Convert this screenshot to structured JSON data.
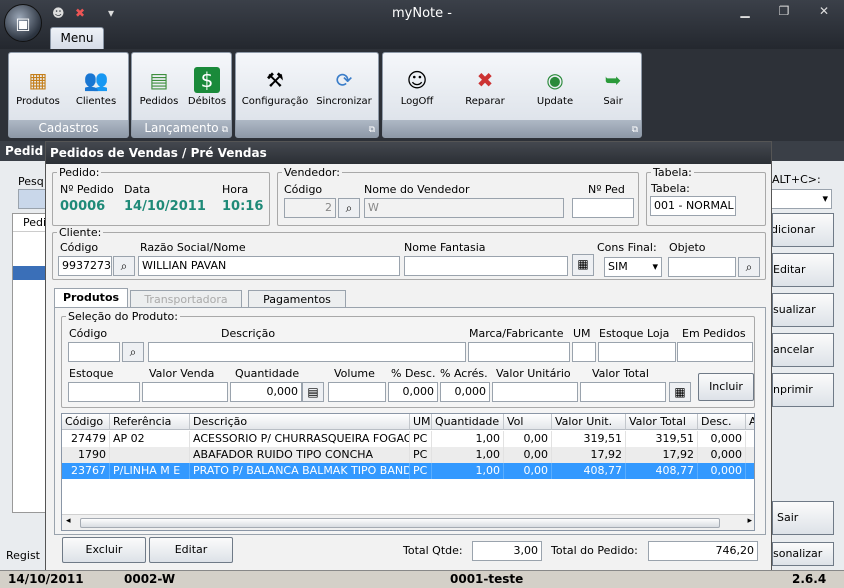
{
  "app": {
    "title": "myNote -",
    "menu_tab": "Menu"
  },
  "ribbon": {
    "groups": [
      {
        "label": "Cadastros",
        "items": [
          {
            "label": "Produtos",
            "icon": "products-icon"
          },
          {
            "label": "Clientes",
            "icon": "clients-icon"
          }
        ]
      },
      {
        "label": "Lançamento",
        "items": [
          {
            "label": "Pedidos",
            "icon": "orders-icon"
          },
          {
            "label": "Débitos",
            "icon": "debits-icon"
          }
        ]
      },
      {
        "label": "",
        "items": [
          {
            "label": "Configuração",
            "icon": "hammer-icon"
          },
          {
            "label": "Sincronizar",
            "icon": "sync-icon"
          }
        ]
      },
      {
        "label": "",
        "items": [
          {
            "label": "LogOff",
            "icon": "logoff-icon"
          },
          {
            "label": "Reparar",
            "icon": "tools-icon"
          },
          {
            "label": "Update",
            "icon": "globe-icon"
          },
          {
            "label": "Sair",
            "icon": "exit-icon"
          }
        ]
      }
    ]
  },
  "background": {
    "title": "Pedid",
    "search_label": "Pesq",
    "col_label": "Pedi",
    "shortcut": "ALT+C>:",
    "footer_label": "Regist",
    "buttons": [
      "dicionar",
      "Editar",
      "sualizar",
      "ancelar",
      "nprimir",
      "Sair",
      "sonalizar"
    ]
  },
  "dialog": {
    "title": "Pedidos de Vendas / Pré Vendas",
    "pedido": {
      "legend": "Pedido:",
      "num_label": "Nº Pedido",
      "num": "00006",
      "date_label": "Data",
      "date": "14/10/2011",
      "hour_label": "Hora",
      "hour": "10:16"
    },
    "vendedor": {
      "legend": "Vendedor:",
      "code_label": "Código",
      "code": "2",
      "name_label": "Nome do Vendedor",
      "name": "W",
      "nped_label": "Nº Ped",
      "nped": ""
    },
    "tabela": {
      "legend": "Tabela:",
      "label": "Tabela:",
      "value": "001 - NORMAL"
    },
    "cliente": {
      "legend": "Cliente:",
      "code_label": "Código",
      "code": "9937273",
      "razao_label": "Razão Social/Nome",
      "razao": "WILLIAN PAVAN",
      "fantasia_label": "Nome Fantasia",
      "fantasia": "",
      "cons_label": "Cons Final:",
      "cons": "SIM",
      "objeto_label": "Objeto",
      "objeto": ""
    },
    "tabs": [
      "Produtos",
      "Transportadora",
      "Pagamentos"
    ],
    "produto": {
      "legend": "Seleção do Produto:",
      "labels": {
        "codigo": "Código",
        "descricao": "Descrição",
        "marca": "Marca/Fabricante",
        "um": "UM",
        "estoque_loja": "Estoque Loja",
        "em_pedidos": "Em Pedidos",
        "estoque": "Estoque",
        "valor_venda": "Valor Venda",
        "quantidade": "Quantidade",
        "volume": "Volume",
        "desc": "% Desc.",
        "acres": "% Acrés.",
        "valor_unitario": "Valor Unitário",
        "valor_total": "Valor Total"
      },
      "quantidade": "0,000",
      "desc": "0,000",
      "acres": "0,000",
      "incluir": "Incluir"
    },
    "grid": {
      "columns": [
        "Código",
        "Referência",
        "Descrição",
        "UM",
        "Quantidade",
        "Vol",
        "Valor Unit.",
        "Valor Total",
        "Desc.",
        "A"
      ],
      "rows": [
        [
          "27479",
          "AP 02",
          "ACESSORIO P/ CHURRASQUEIRA FOGAO",
          "PC",
          "1,00",
          "0,00",
          "319,51",
          "319,51",
          "0,000"
        ],
        [
          "1790",
          "",
          "ABAFADOR RUIDO TIPO CONCHA",
          "PC",
          "1,00",
          "0,00",
          "17,92",
          "17,92",
          "0,000"
        ],
        [
          "23767",
          "P/LINHA M E",
          "PRATO P/ BALANCA BALMAK TIPO BANDEJA",
          "PC",
          "1,00",
          "0,00",
          "408,77",
          "408,77",
          "0,000"
        ]
      ],
      "selected_row": 2
    },
    "footer": {
      "excluir": "Excluir",
      "editar": "Editar",
      "total_qtde_label": "Total Qtde:",
      "total_qtde": "3,00",
      "total_pedido_label": "Total do Pedido:",
      "total_pedido": "746,20"
    }
  },
  "status": {
    "date": "14/10/2011",
    "user": "0002-W",
    "company": "0001-teste",
    "version": "2.6.4"
  }
}
